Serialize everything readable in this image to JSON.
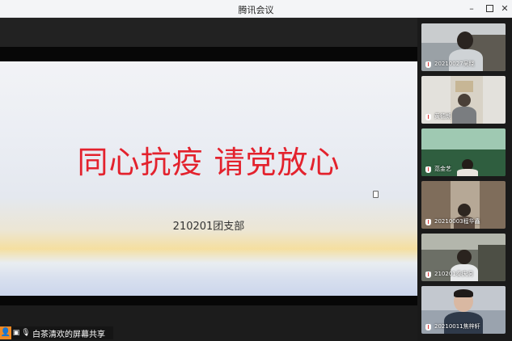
{
  "window": {
    "title": "腾讯会议",
    "minimize_label": "–",
    "close_label": "✕"
  },
  "slide": {
    "slogan": "同心抗疫  请党放心",
    "department": "210201团支部"
  },
  "share_bar": {
    "text": "白茶清欢的屏幕共享",
    "user_icon": "user-icon",
    "screen_icon": "screen-share-icon",
    "mic_icon": "microphone-icon"
  },
  "participants": [
    {
      "name": "20210027吴晓"
    },
    {
      "name": "黄德朗"
    },
    {
      "name": "范金艺"
    },
    {
      "name": "20210003程华鑫"
    },
    {
      "name": "210201秦庆洞"
    },
    {
      "name": "20210011焦梓轩"
    }
  ],
  "colors": {
    "slogan": "#e3222d",
    "share_person": "#f08a24",
    "sidebar": "#1a1a1a"
  }
}
